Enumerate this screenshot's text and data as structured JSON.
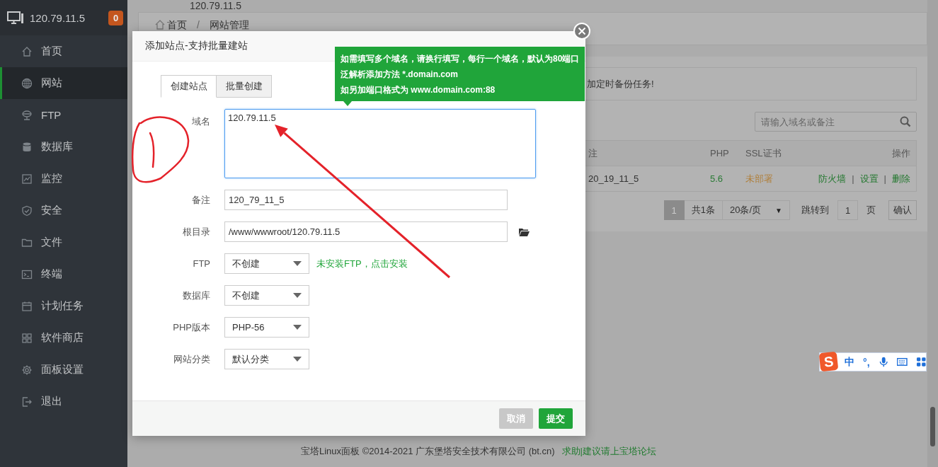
{
  "top_label": "120.79.11.5",
  "sidebar": {
    "host": "120.79.11.5",
    "badge": "0",
    "items": [
      {
        "label": "首页",
        "kind": "home",
        "selected": false
      },
      {
        "label": "网站",
        "kind": "globe",
        "selected": true
      },
      {
        "label": "FTP",
        "kind": "ftp",
        "selected": false
      },
      {
        "label": "数据库",
        "kind": "database",
        "selected": false
      },
      {
        "label": "监控",
        "kind": "monitor",
        "selected": false
      },
      {
        "label": "安全",
        "kind": "shield",
        "selected": false
      },
      {
        "label": "文件",
        "kind": "folder",
        "selected": false
      },
      {
        "label": "终端",
        "kind": "terminal",
        "selected": false
      },
      {
        "label": "计划任务",
        "kind": "calendar",
        "selected": false
      },
      {
        "label": "软件商店",
        "kind": "apps",
        "selected": false
      },
      {
        "label": "面板设置",
        "kind": "gear",
        "selected": false
      },
      {
        "label": "退出",
        "kind": "logout",
        "selected": false
      }
    ]
  },
  "breadcrumb": {
    "items": [
      "首页",
      "网站管理"
    ],
    "separator": "/"
  },
  "alert": "加定时备份任务!",
  "search": {
    "placeholder": "请输入域名或备注"
  },
  "table": {
    "columns": [
      "注",
      "PHP",
      "SSL证书",
      "操作"
    ],
    "action_separator": "|",
    "rows": [
      {
        "note": "20_19_11_5",
        "php": "5.6",
        "ssl": "未部署",
        "actions": [
          "防火墙",
          "设置",
          "删除"
        ]
      }
    ]
  },
  "pagination": {
    "pages": [
      {
        "label": "1",
        "selected": true
      }
    ],
    "total": "共1条",
    "page_size": "20条/页",
    "page_size_caret": "▼",
    "goto_label": "跳转到",
    "goto_value": "1",
    "page_unit": "页",
    "confirm": "确认"
  },
  "footer": {
    "copyright": "宝塔Linux面板 ©2014-2021 广东堡塔安全技术有限公司 (bt.cn)",
    "link": "求助|建议请上宝塔论坛"
  },
  "dialog": {
    "title": "添加站点-支持批量建站",
    "tabs": [
      {
        "label": "创建站点",
        "selected": true
      },
      {
        "label": "批量创建",
        "selected": false
      }
    ],
    "fields": [
      {
        "label": "域名",
        "kind": "textarea",
        "value": "120.79.11.5"
      },
      {
        "label": "备注",
        "kind": "input",
        "value": "120_79_11_5"
      },
      {
        "label": "根目录",
        "kind": "path",
        "value": "/www/wwwroot/120.79.11.5"
      },
      {
        "label": "FTP",
        "kind": "select",
        "value": "不创建",
        "hint": "未安装FTP，点击安装"
      },
      {
        "label": "数据库",
        "kind": "select",
        "value": "不创建"
      },
      {
        "label": "PHP版本",
        "kind": "select",
        "value": "PHP-56"
      },
      {
        "label": "网站分类",
        "kind": "select",
        "value": "默认分类"
      }
    ],
    "buttons": [
      {
        "label": "取消",
        "kind": "cancel"
      },
      {
        "label": "提交",
        "kind": "primary"
      }
    ],
    "tooltip": [
      "如需填写多个域名，请换行填写，每行一个域名，默认为80端口",
      "泛解析添加方法 *.domain.com",
      "如另加端口格式为 www.domain.com:88"
    ]
  },
  "ime_toolbar": {
    "logo": "S",
    "mode": "中",
    "punctuation": "°,"
  }
}
